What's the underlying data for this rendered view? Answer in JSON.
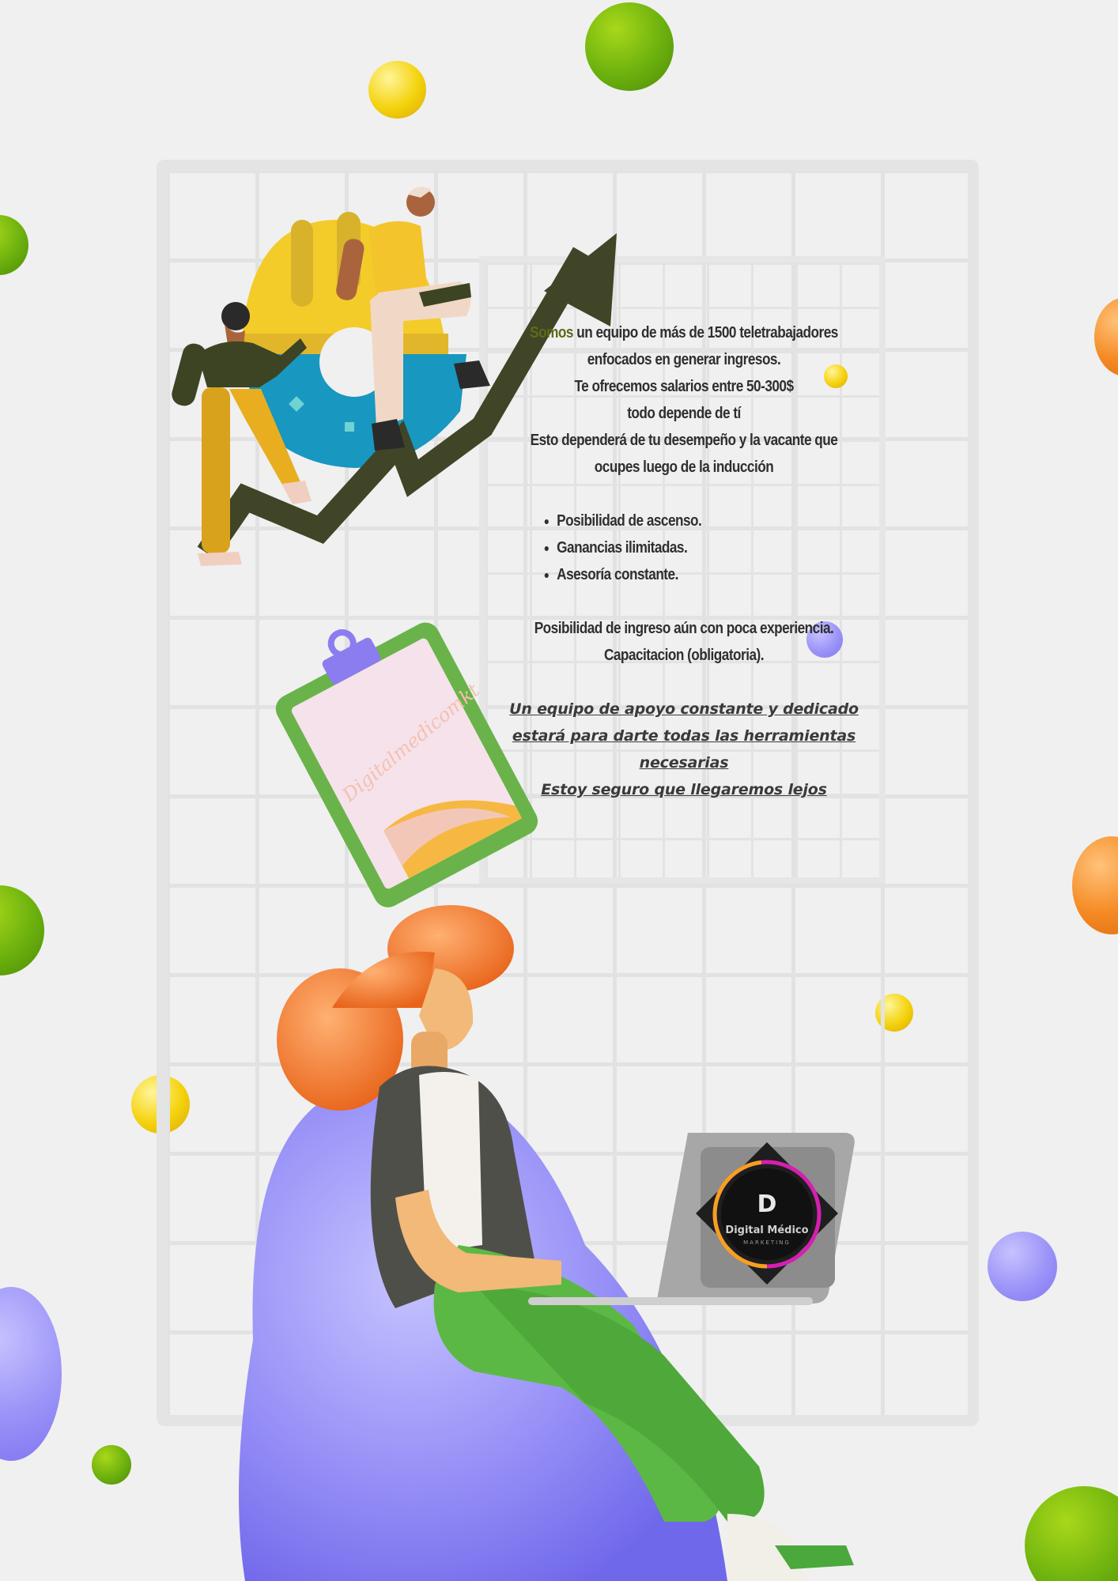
{
  "intro": {
    "line1_highlight": "Somos",
    "line1_rest": " un equipo de más de 1500 teletrabajadores",
    "line2": "enfocados en generar ingresos.",
    "line3": "Te ofrecemos salarios entre 50-300$",
    "line4": "todo depende de tí",
    "line5": "Esto dependerá de tu desempeño y la vacante que",
    "line6": "ocupes luego de la inducción"
  },
  "benefits": [
    "Posibilidad de ascenso.",
    "Ganancias ilimitadas.",
    "Asesoría constante."
  ],
  "notes": {
    "line1": "Posibilidad de ingreso aún con poca experiencia.",
    "line2": "Capacitacion (obligatoria)."
  },
  "support": {
    "line1": "Un equipo de apoyo constante y dedicado",
    "line2": "estará para darte todas las herramientas",
    "line3": "necesarias",
    "line4": "Estoy seguro que llegaremos lejos"
  },
  "clipboard_watermark": "Digitalmedicomkt",
  "laptop_logo": {
    "name": "Digital Médico",
    "tagline": "MARKETING"
  },
  "colors": {
    "background": "#f0f0f0",
    "text": "#2f2f2f",
    "arrow": "#3f4526",
    "green_ball": "#6cb10e",
    "yellow_ball": "#f4d20c",
    "orange_ball": "#f58b24",
    "purple_ball": "#9b94f8"
  }
}
